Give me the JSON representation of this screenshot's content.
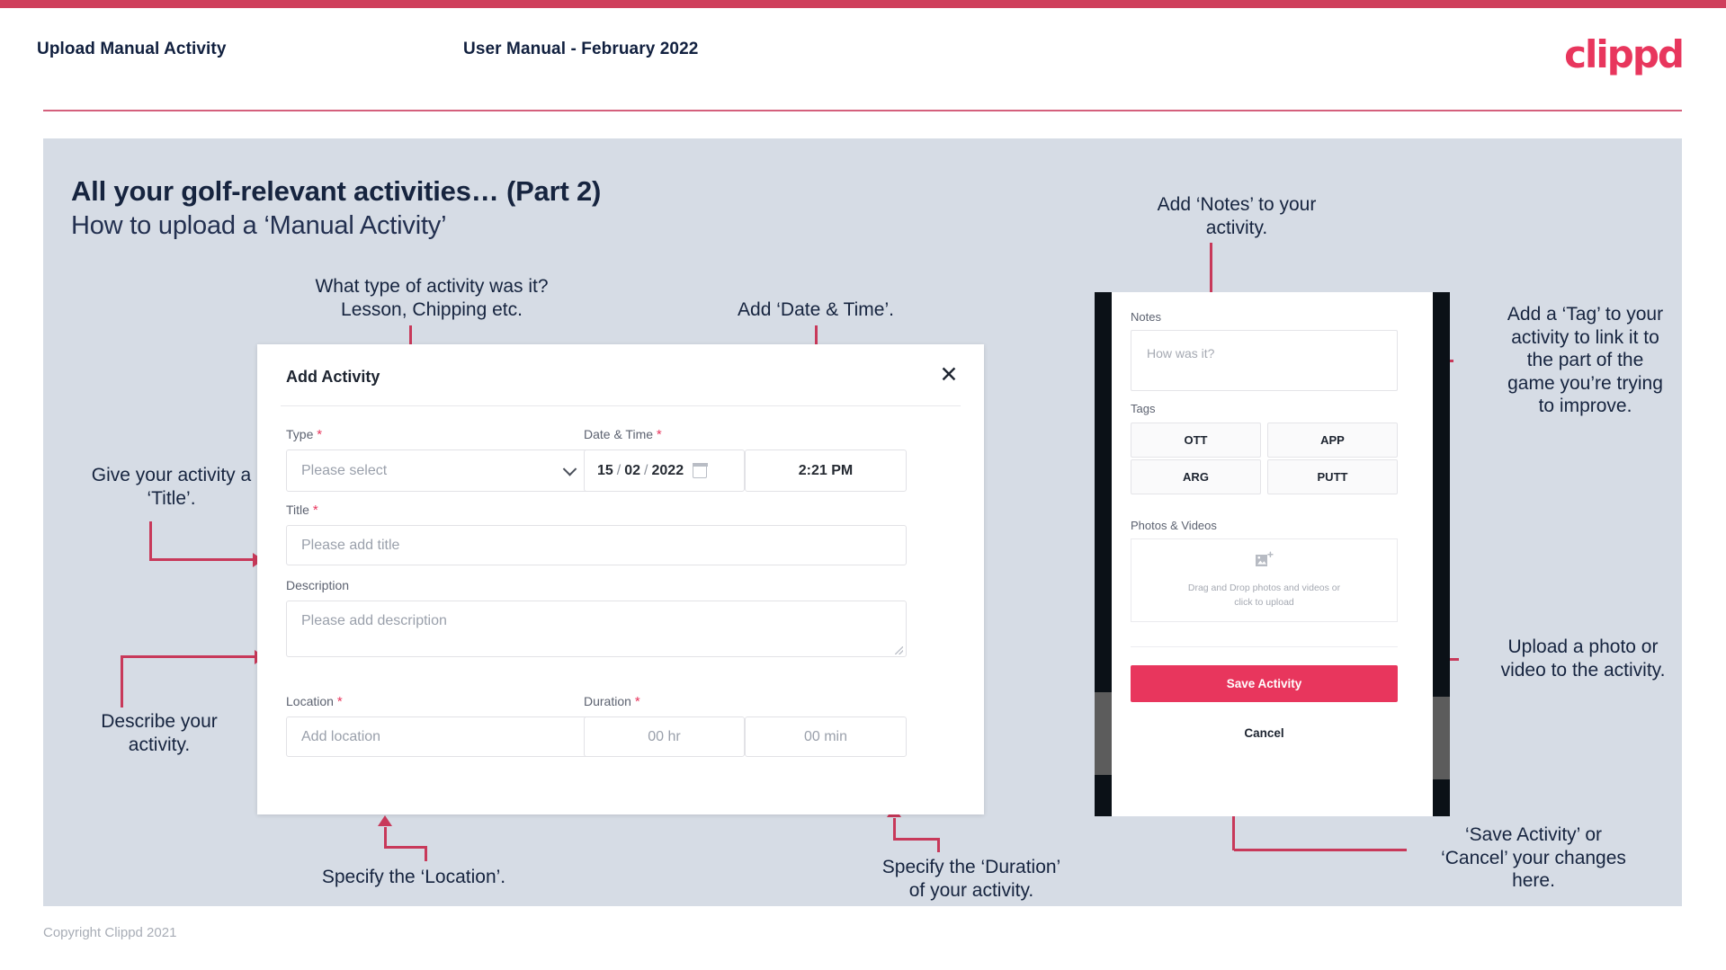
{
  "theme": {
    "crimson": "#cf3f5c",
    "accent": "#e8365d",
    "arrow": "#c8395a",
    "slide_bg": "#d6dce5",
    "ink": "#16243f"
  },
  "header": {
    "left_title": "Upload Manual Activity",
    "center_title": "User Manual - February 2022",
    "logo_text": "clippd"
  },
  "slide": {
    "title": "All your golf-relevant activities… (Part 2)",
    "subtitle": "How to upload a ‘Manual Activity’"
  },
  "annotations": {
    "type": "What type of activity was it?\nLesson, Chipping etc.",
    "datetime": "Add ‘Date & Time’.",
    "title_field": "Give your activity a\n‘Title’.",
    "description": "Describe your\nactivity.",
    "location": "Specify the ‘Location’.",
    "duration": "Specify the ‘Duration’\nof your activity.",
    "notes": "Add ‘Notes’ to your\nactivity.",
    "tags": "Add a ‘Tag’ to your\nactivity to link it to\nthe part of the\ngame you’re trying\nto improve.",
    "photos": "Upload a photo or\nvideo to the activity.",
    "save_cancel": "‘Save Activity’ or\n‘Cancel’ your changes\nhere."
  },
  "dialog": {
    "title": "Add Activity",
    "close_icon": "close-icon",
    "fields": {
      "type": {
        "label": "Type",
        "required": "*",
        "placeholder": "Please select",
        "caret_icon": "chevron-down-icon"
      },
      "datetime": {
        "label": "Date & Time",
        "required": "*",
        "day": "15",
        "sep1": "/",
        "month": "02",
        "sep2": "/",
        "year": "2022",
        "calendar_icon": "calendar-icon",
        "time": "2:21 PM"
      },
      "title": {
        "label": "Title",
        "required": "*",
        "placeholder": "Please add title"
      },
      "description": {
        "label": "Description",
        "required": "",
        "placeholder": "Please add description"
      },
      "location": {
        "label": "Location",
        "required": "*",
        "placeholder": "Add location"
      },
      "duration": {
        "label": "Duration",
        "required": "*",
        "hours_placeholder": "00 hr",
        "minutes_placeholder": "00 min"
      }
    }
  },
  "phone": {
    "notes": {
      "label": "Notes",
      "placeholder": "How was it?"
    },
    "tags": {
      "label": "Tags",
      "items": [
        "OTT",
        "APP",
        "ARG",
        "PUTT"
      ]
    },
    "photos": {
      "label": "Photos & Videos",
      "icon": "add-image-icon",
      "dropzone_line1": "Drag and Drop photos and videos or",
      "dropzone_line2": "click to upload"
    },
    "save_label": "Save Activity",
    "cancel_label": "Cancel"
  },
  "footer": {
    "copyright": "Copyright Clippd 2021"
  }
}
